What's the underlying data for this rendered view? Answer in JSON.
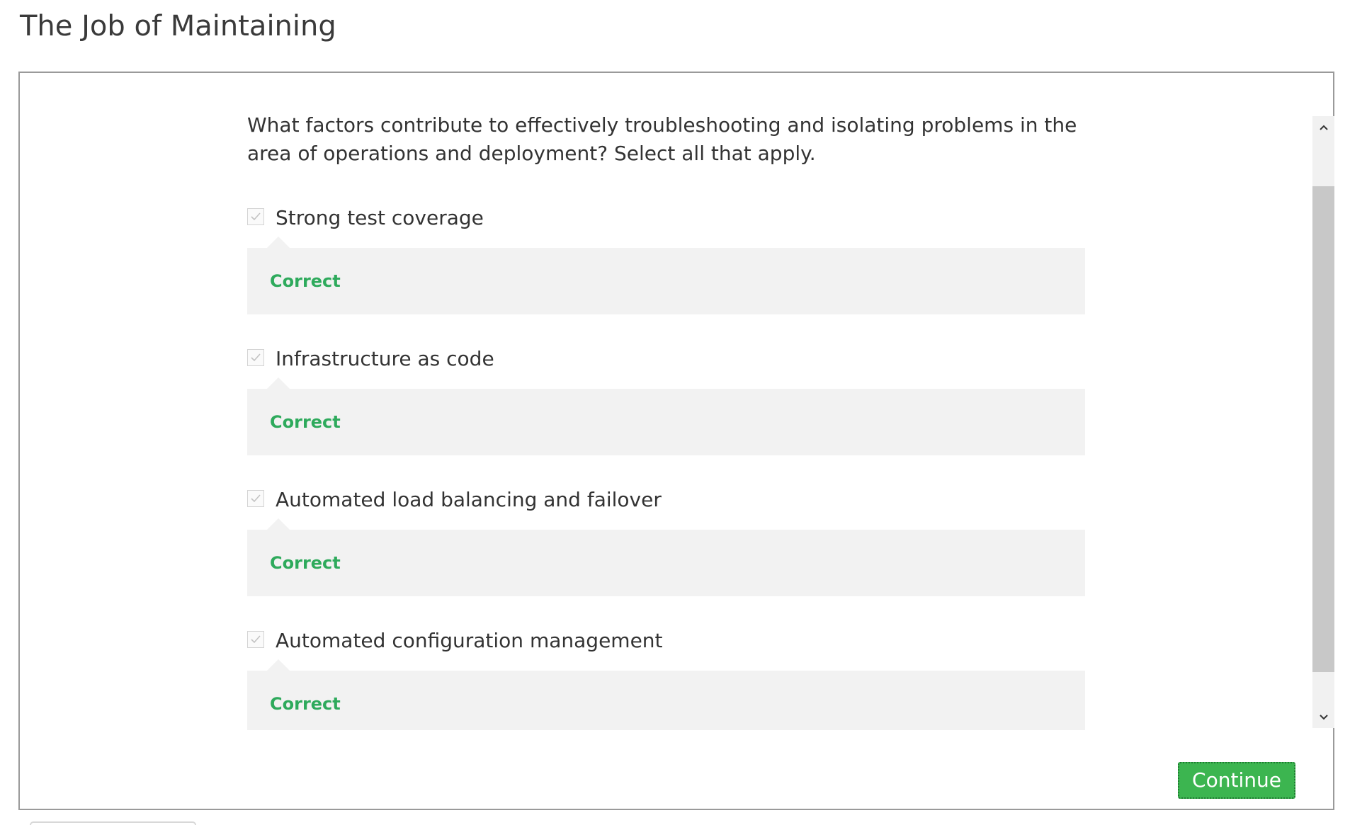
{
  "page": {
    "title": "The Job of Maintaining"
  },
  "question": {
    "text": "What factors contribute to effectively troubleshooting and isolating problems in the area of operations and deployment? Select all that apply."
  },
  "options": [
    {
      "label": "Strong test coverage",
      "checked": true,
      "feedback": "Correct"
    },
    {
      "label": "Infrastructure as code",
      "checked": true,
      "feedback": "Correct"
    },
    {
      "label": "Automated load balancing and failover",
      "checked": true,
      "feedback": "Correct"
    },
    {
      "label": "Automated configuration management",
      "checked": true,
      "feedback": "Correct"
    }
  ],
  "actions": {
    "continue_label": "Continue"
  },
  "scrollbar": {
    "up_icon": "chevron-up-icon",
    "down_icon": "chevron-down-icon"
  },
  "colors": {
    "correct": "#2eaa5c",
    "continue_button": "#3cb550",
    "feedback_background": "#f2f2f2"
  }
}
